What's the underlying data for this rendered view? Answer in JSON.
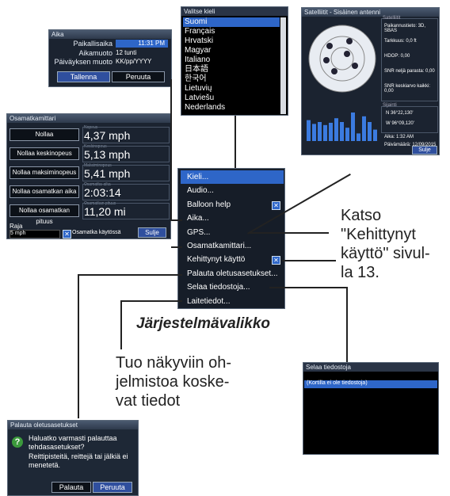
{
  "aika": {
    "title": "Aika",
    "rows": [
      {
        "label": "Paikallisaika",
        "value": "11:31 PM"
      },
      {
        "label": "Aikamuoto",
        "value": "12 tunti"
      },
      {
        "label": "Päiväyksen muoto",
        "value": "KK/pp/YYYY"
      }
    ],
    "save": "Tallenna",
    "cancel": "Peruuta"
  },
  "kieli": {
    "title": "Valitse kieli",
    "items": [
      "Suomi",
      "Français",
      "Hrvatski",
      "Magyar",
      "Italiano",
      "日本語",
      "한국어",
      "Lietuvių",
      "Latviešu",
      "Nederlands"
    ]
  },
  "sat": {
    "title": "Satelliitit - Sisäinen antenni",
    "section1": "Satelliitit",
    "info": [
      "Paikannustieto: 3D, SBAS",
      "Tarkkuus: 0,0 ft",
      "HDOP: 0,00",
      "SNR neljä parasta: 0,00",
      "SNR keskiarvo kaikki: 0,00"
    ],
    "section2": "Sijainti",
    "pos": [
      "N 36°22,130'",
      "W 96°09,120'"
    ],
    "time": "Aika: 1:32 AM",
    "date": "Päivämäärä: 12/09/2015",
    "close": "Sulje",
    "sv_bars": [
      0.55,
      0.45,
      0.5,
      0.42,
      0.48,
      0.6,
      0.5,
      0.35,
      0.75,
      0.2,
      0.65,
      0.5,
      0.3
    ]
  },
  "osa": {
    "title": "Osamatkamittari",
    "rows": [
      {
        "btn": "Nollaa",
        "cap": "Nopeus",
        "val": "4,37 mph"
      },
      {
        "btn": "Nollaa keskinopeus",
        "cap": "Keskinopeus",
        "val": "5,13 mph"
      },
      {
        "btn": "Nollaa maksiminopeus",
        "cap": "Maksiminopeus",
        "val": "5,41 mph"
      },
      {
        "btn": "Nollaa osamatkan aika",
        "cap": "Osamatka-aika",
        "val": "2:03:14"
      },
      {
        "btn": "Nollaa osamatkan pituus",
        "cap": "Osamatkan pituus",
        "val": "11,20 mi"
      }
    ],
    "limit_label": "Raja",
    "limit": "5 mph",
    "enable": "Osamatka käytössä",
    "close": "Sulje"
  },
  "menu": {
    "items": [
      "Kieli...",
      "Audio...",
      "Balloon help",
      "Aika...",
      "GPS...",
      "Osamatkamittari...",
      "Kehittynyt käyttö",
      "Palauta oletusasetukset...",
      "Selaa tiedostoja...",
      "Laitetiedot..."
    ],
    "caption": "Järjestelmävalikko"
  },
  "callouts": {
    "katso": "Katso\n\"Kehittynyt\nkäyttö\" sivul-\nla 13.",
    "tuo": "Tuo näkyviin oh-\njelmistoa koske-\nvat tiedot"
  },
  "selaa": {
    "title": "Selaa tiedostoja",
    "item": "(Kortilla ei ole tiedostoja)"
  },
  "palauta": {
    "title": "Palauta oletusasetukset",
    "q": "Haluatko varmasti palauttaa tehdasasetukset?",
    "note": "Reittipisteitä, reittejä tai jälkiä ei menetetä.",
    "ok": "Palauta",
    "cancel": "Peruuta"
  }
}
